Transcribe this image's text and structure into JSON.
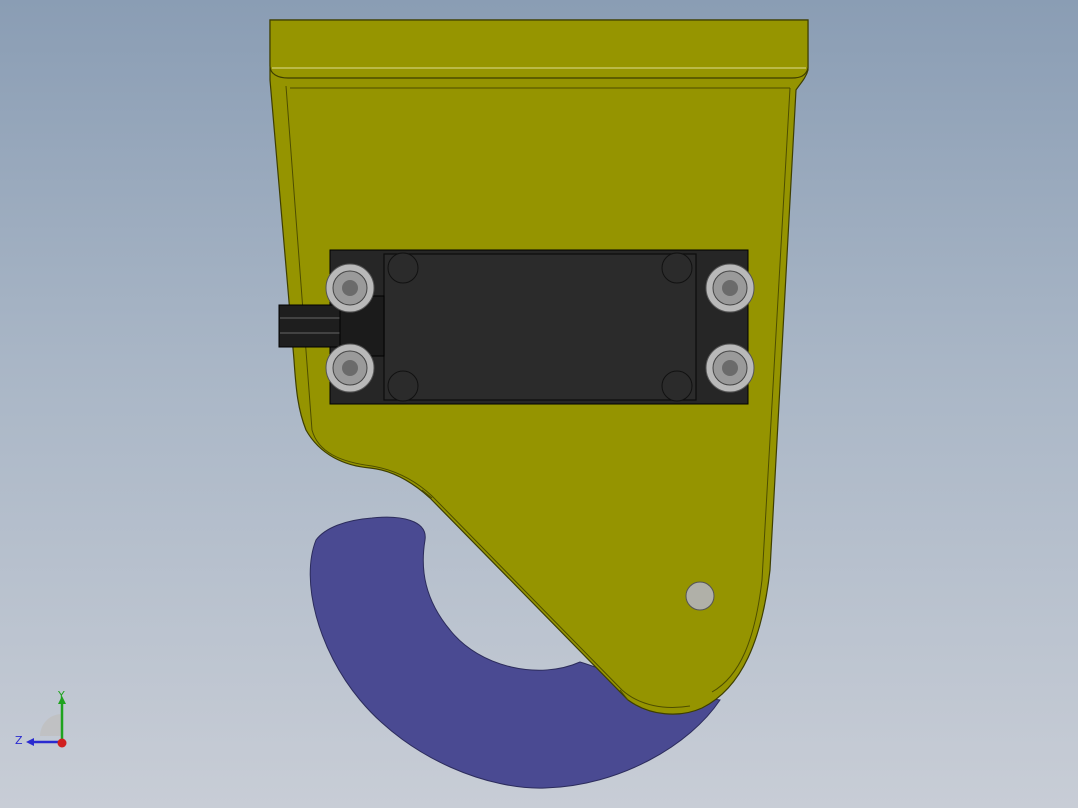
{
  "viewport": {
    "background_top": "#8a9db4",
    "background_bottom": "#c8cdd6"
  },
  "model": {
    "body_color": "#959400",
    "body_edge_color": "#3e3e00",
    "hook_color": "#4a4a92",
    "servo_color": "#262626",
    "screw_color": "#c8c8c8",
    "pin_color": "#b0b0a8"
  },
  "triad": {
    "x_label": "",
    "y_label": "Y",
    "z_label": "Z",
    "y_color": "#1fa31f",
    "z_color": "#2a2ad0",
    "x_color": "#d01f1f"
  }
}
